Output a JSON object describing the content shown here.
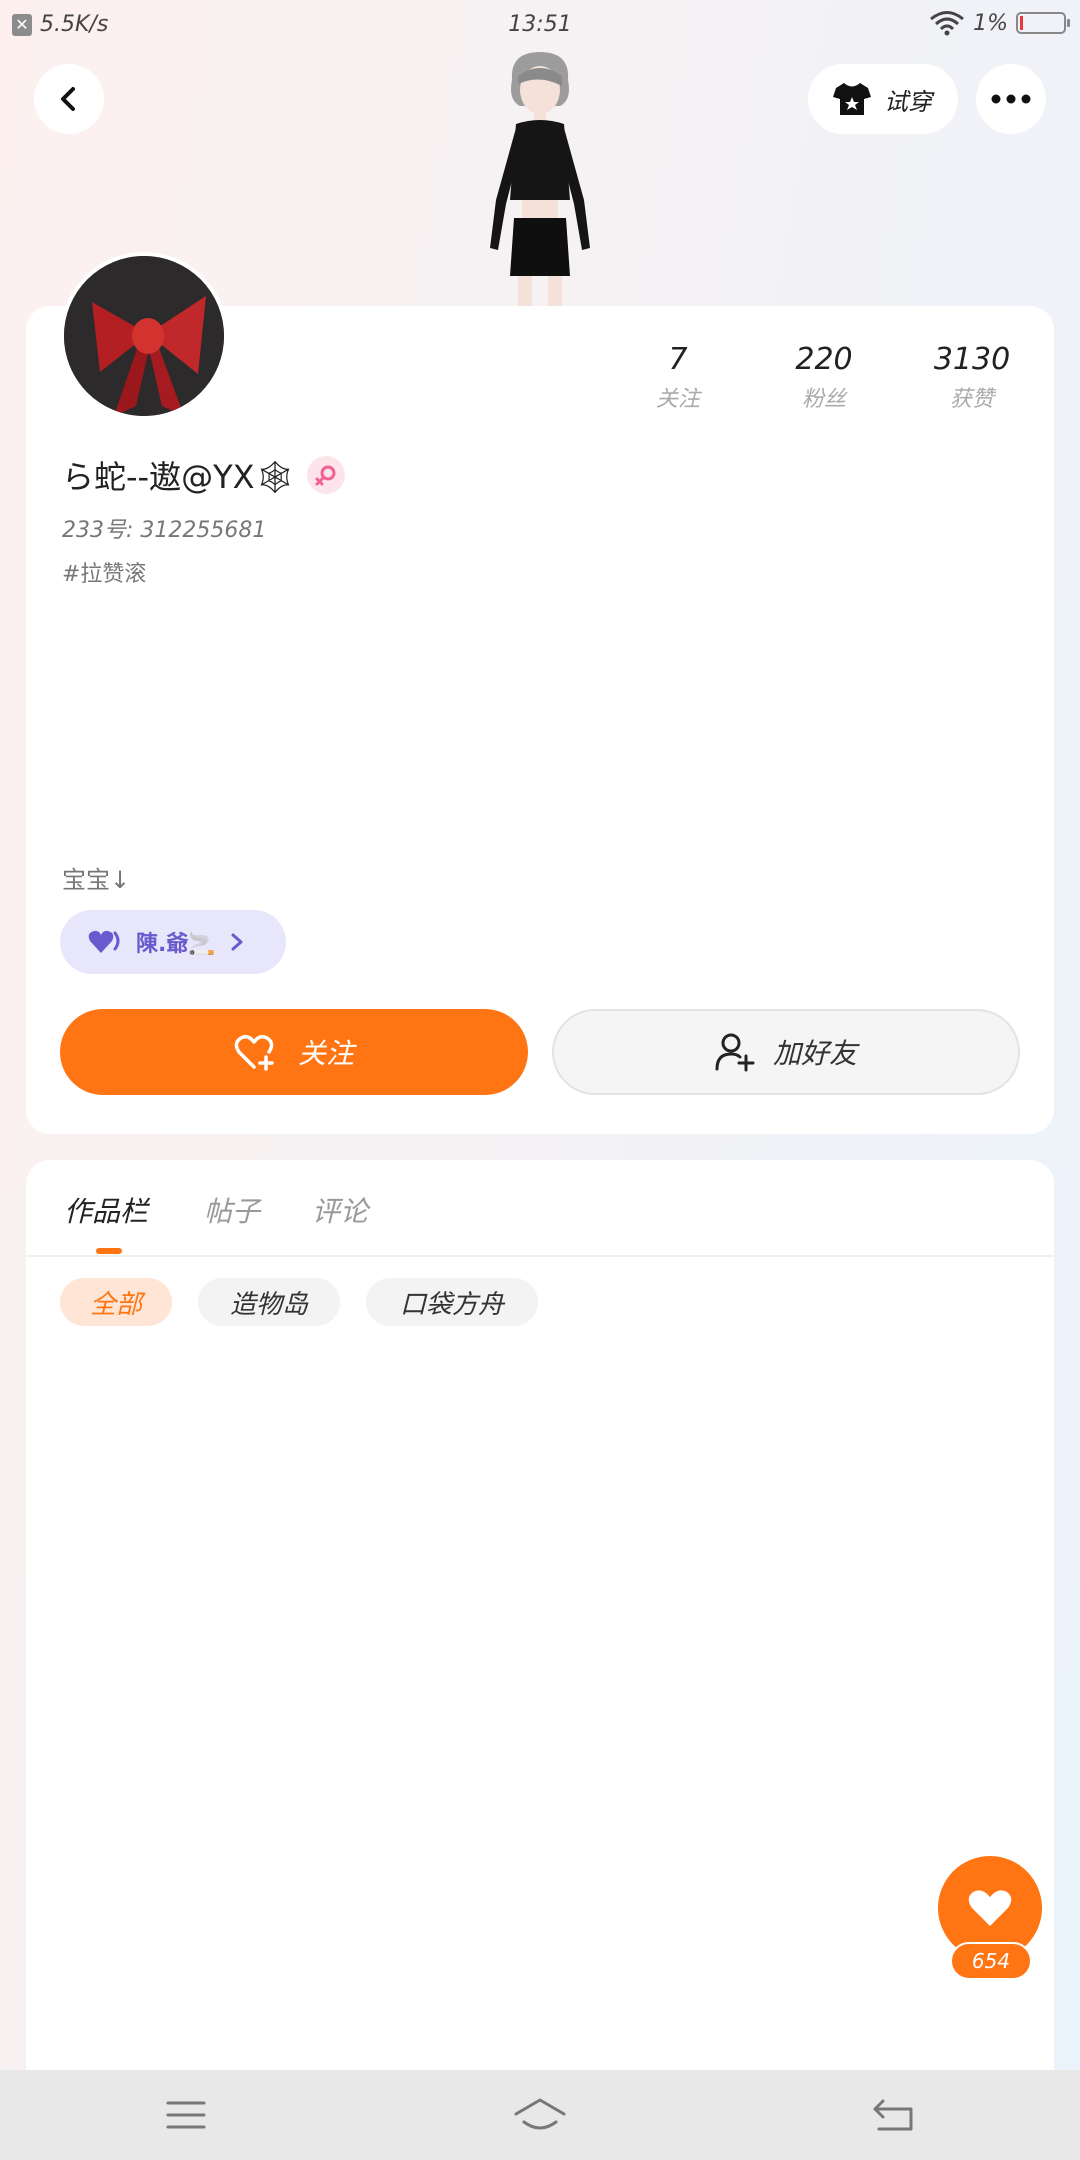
{
  "status_bar": {
    "net_speed": "5.5K/s",
    "time": "13:51",
    "battery_percent": "1%"
  },
  "header": {
    "try_on_label": "试穿"
  },
  "profile": {
    "stats": [
      {
        "value": "7",
        "label": "关注"
      },
      {
        "value": "220",
        "label": "粉丝"
      },
      {
        "value": "3130",
        "label": "获赞"
      }
    ],
    "username": "ら蛇--遨@YX🕸",
    "uid_line": "233号: 312255681",
    "tag": "#拉赞滚",
    "baby_line": "宝宝↓",
    "linked_friend": "陳.爺🚬",
    "follow_label": "关注",
    "add_friend_label": "加好友"
  },
  "content": {
    "tabs": [
      "作品栏",
      "帖子",
      "评论"
    ],
    "active_tab": 0,
    "filters": [
      "全部",
      "造物岛",
      "口袋方舟"
    ],
    "active_filter": 0
  },
  "like_fab": {
    "count": "654"
  },
  "colors": {
    "accent": "#ff7513",
    "link_chip_bg": "#e8e6fa",
    "link_chip_text": "#6a5acd"
  }
}
